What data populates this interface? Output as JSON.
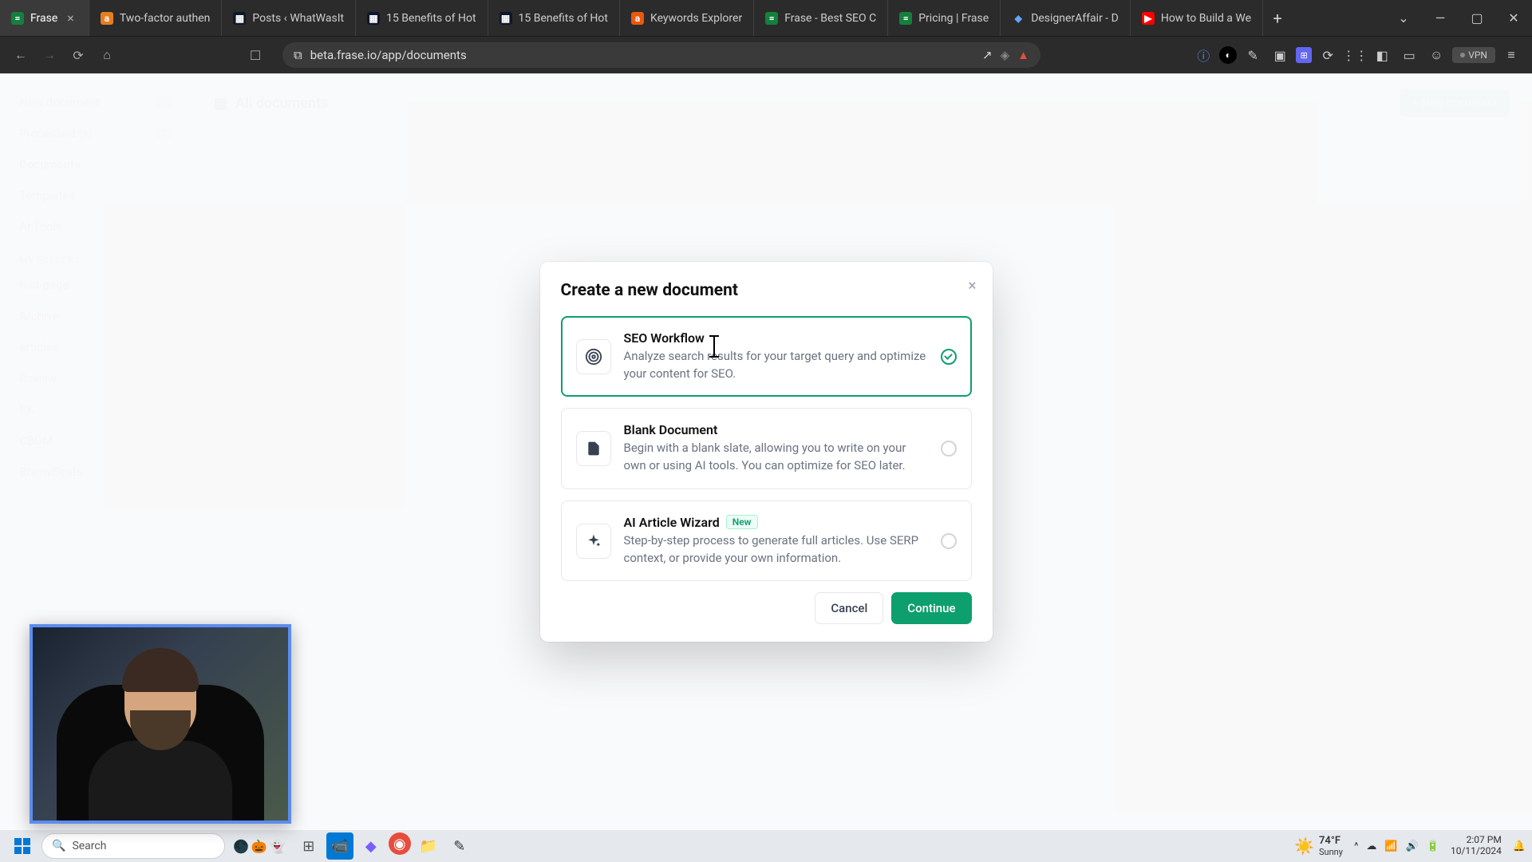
{
  "tabs": [
    {
      "title": "Frase",
      "icon": "frase",
      "active": true
    },
    {
      "title": "Two-factor authen",
      "icon": "orange"
    },
    {
      "title": "Posts ‹ WhatWasIt",
      "icon": "dark"
    },
    {
      "title": "15 Benefits of Hot",
      "icon": "dark"
    },
    {
      "title": "15 Benefits of Hot",
      "icon": "dark"
    },
    {
      "title": "Keywords Explorer",
      "icon": "key"
    },
    {
      "title": "Frase - Best SEO C",
      "icon": "frase"
    },
    {
      "title": "Pricing | Frase",
      "icon": "frase"
    },
    {
      "title": "DesignerAffair - D",
      "icon": "quest"
    },
    {
      "title": "How to Build a We",
      "icon": "yt"
    }
  ],
  "url": "beta.frase.io/app/documents",
  "vpn_label": "VPN",
  "sidebar": {
    "items_primary": [
      {
        "label": "New document",
        "count": "1"
      },
      {
        "label": "Processed (x)",
        "count": "3"
      }
    ],
    "doc_label": "Documents",
    "items_docs": [
      "Templates",
      "AI Tools"
    ],
    "folders_header": "My Folders",
    "folder_items": [
      "test page",
      "Archive",
      "articles",
      "Review",
      "PK",
      "CBDM",
      "BrainyBeats"
    ]
  },
  "main": {
    "title": "All documents",
    "new_btn": "+ New document"
  },
  "modal": {
    "title": "Create a new document",
    "options": [
      {
        "title": "SEO Workflow",
        "desc": "Analyze search results for your target query and optimize your content for SEO.",
        "selected": true,
        "icon": "target"
      },
      {
        "title": "Blank Document",
        "desc": "Begin with a blank slate, allowing you to write on your own or using AI tools. You can optimize for SEO later.",
        "selected": false,
        "icon": "file"
      },
      {
        "title": "AI Article Wizard",
        "desc": "Step-by-step process to generate full articles. Use SERP context, or provide your own information.",
        "selected": false,
        "icon": "sparkle",
        "badge": "New"
      }
    ],
    "cancel": "Cancel",
    "continue": "Continue"
  },
  "taskbar": {
    "search": "Search",
    "weather_temp": "74°F",
    "weather_cond": "Sunny",
    "time": "2:07 PM",
    "date": "10/11/2024"
  }
}
